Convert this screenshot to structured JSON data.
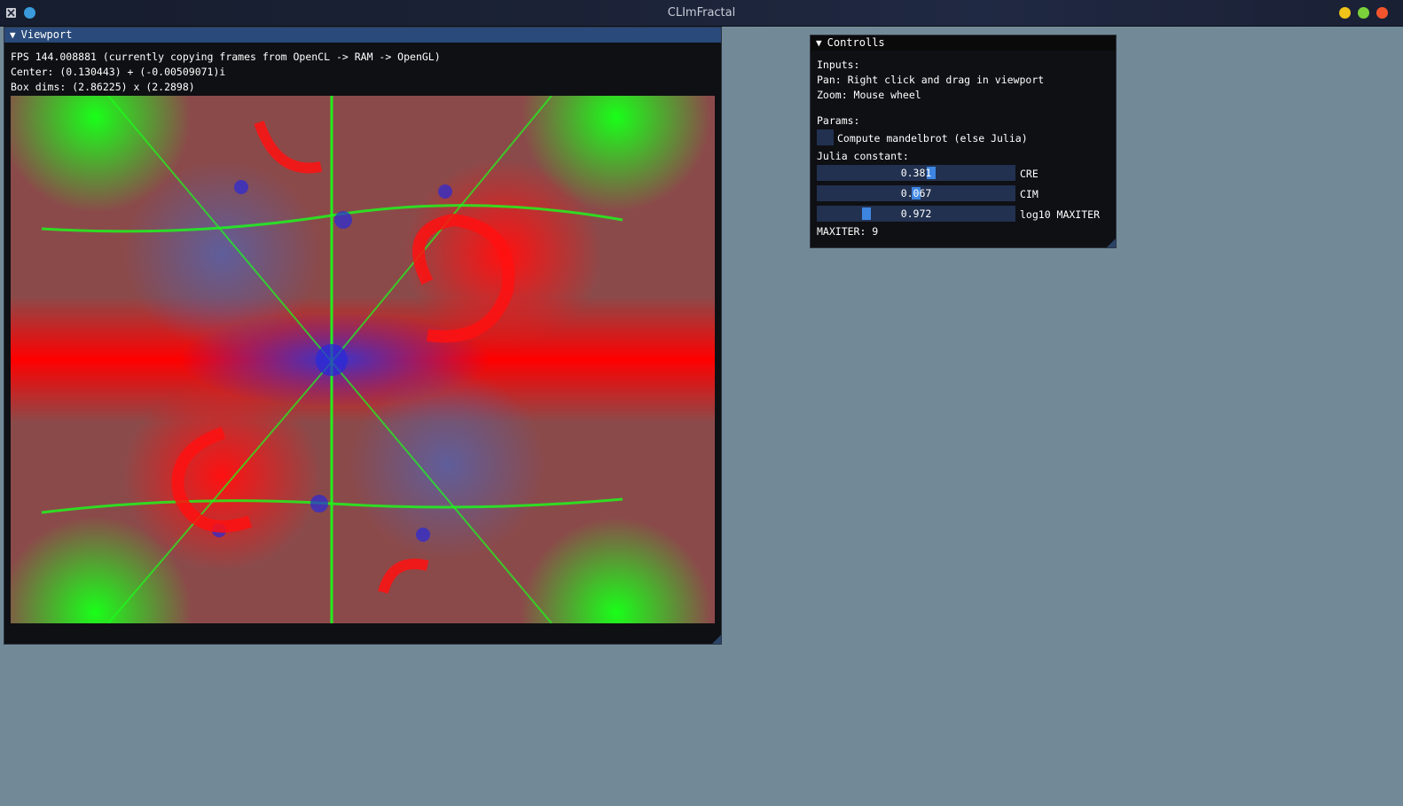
{
  "os": {
    "title": "CLImFractal",
    "left_dot_color": "#3a9bdc",
    "buttons": [
      {
        "name": "minimize",
        "color": "#f0c419"
      },
      {
        "name": "maximize",
        "color": "#7bd13a"
      },
      {
        "name": "close",
        "color": "#f2552c"
      }
    ]
  },
  "viewport": {
    "title": "Viewport",
    "lines": [
      "FPS 144.008881 (currently copying frames from OpenCL -> RAM -> OpenGL)",
      "Center: (0.130443) + (-0.00509071)i",
      "Box dims: (2.86225) x (2.2898)"
    ],
    "fractal_colors": {
      "background": "#8b4a4a",
      "red": "#ff0000",
      "green": "#19ff19",
      "blue": "#2020e0"
    }
  },
  "controls": {
    "title": "Controlls",
    "inputs_header": "Inputs:",
    "pan_text": "Pan: Right click and drag in viewport",
    "zoom_text": "Zoom: Mouse wheel",
    "params_header": "Params:",
    "mandelbrot_checkbox": {
      "label": "Compute mandelbrot (else Julia)",
      "checked": false
    },
    "julia_header": "Julia constant:",
    "sliders": [
      {
        "value_text": "0.381",
        "label": "CRE",
        "fraction": 0.58
      },
      {
        "value_text": "0.067",
        "label": "CIM",
        "fraction": 0.5
      },
      {
        "value_text": "0.972",
        "label": "log10 MAXITER",
        "fraction": 0.24
      }
    ],
    "maxiter_text": "MAXITER: 9"
  }
}
